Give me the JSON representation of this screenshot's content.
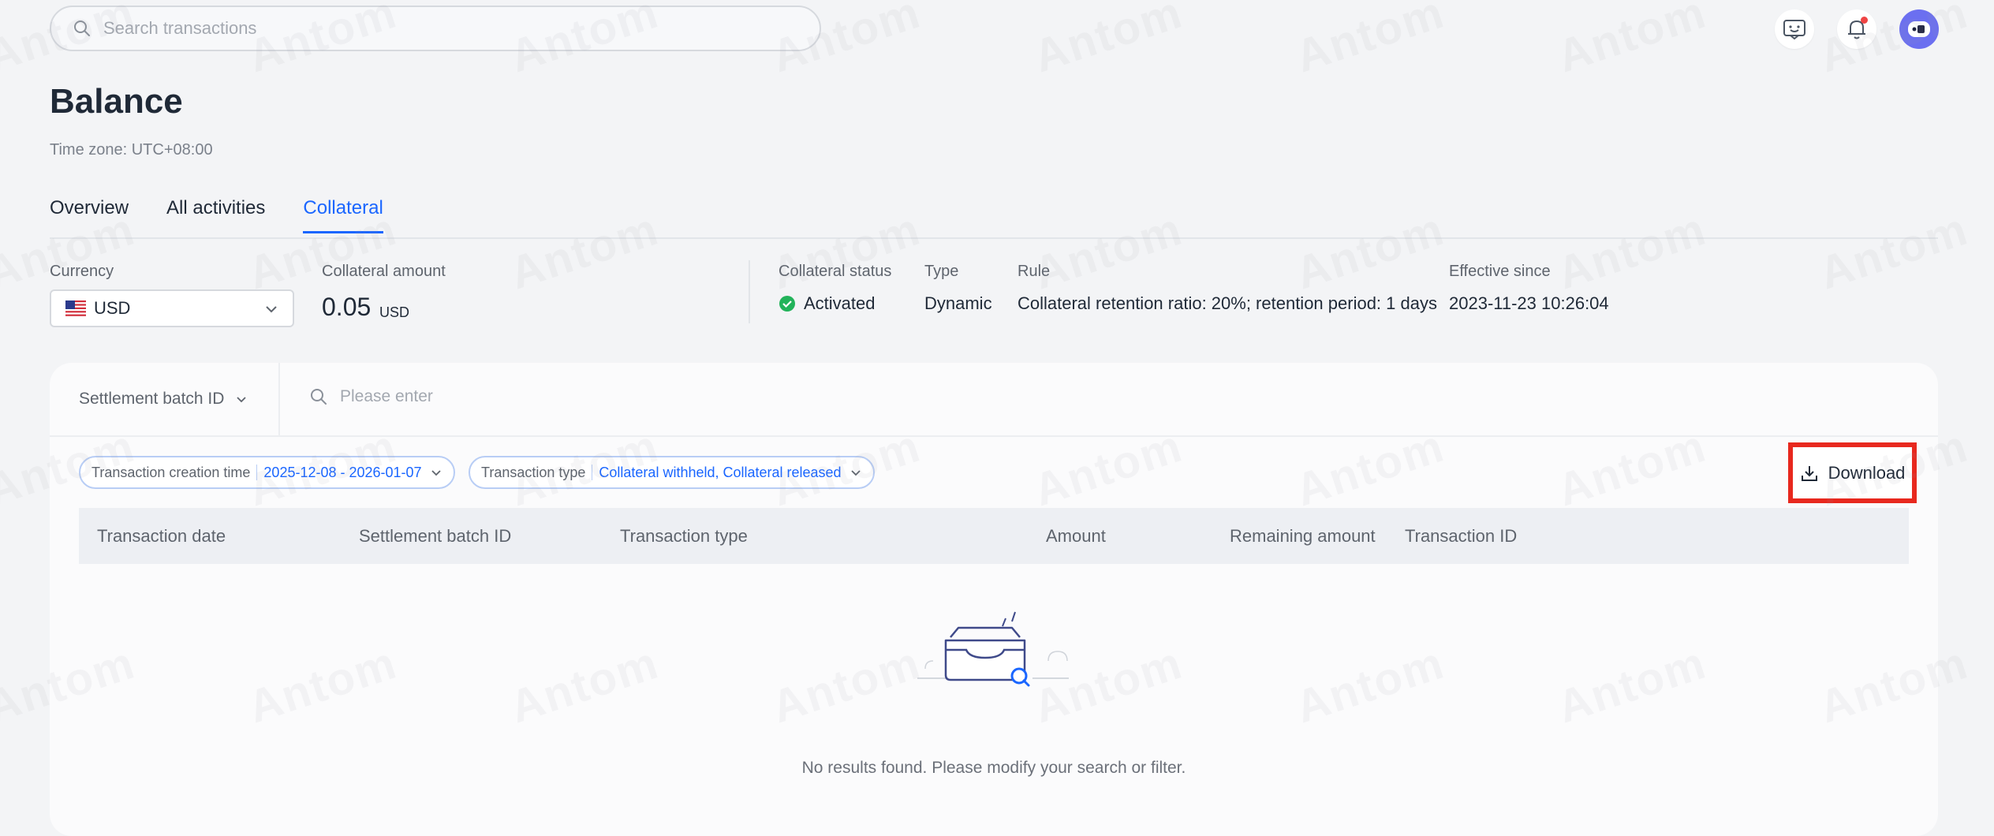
{
  "search": {
    "placeholder": "Search transactions"
  },
  "header": {
    "title": "Balance",
    "timezone": "Time zone: UTC+08:00"
  },
  "tabs": [
    {
      "label": "Overview",
      "active": false
    },
    {
      "label": "All activities",
      "active": false
    },
    {
      "label": "Collateral",
      "active": true
    }
  ],
  "info": {
    "currency_label": "Currency",
    "currency_value": "USD",
    "collateral_amount_label": "Collateral amount",
    "collateral_amount_value": "0.05",
    "collateral_amount_unit": "USD",
    "status_label": "Collateral status",
    "status_value": "Activated",
    "type_label": "Type",
    "type_value": "Dynamic",
    "rule_label": "Rule",
    "rule_value": "Collateral retention ratio: 20%; retention period: 1 days",
    "effective_label": "Effective since",
    "effective_value": "2023-11-23 10:26:04"
  },
  "filters": {
    "batch_select_label": "Settlement batch ID",
    "search_placeholder": "Please enter",
    "chips": [
      {
        "label": "Transaction creation time",
        "value": "2025-12-08 - 2026-01-07"
      },
      {
        "label": "Transaction type",
        "value": "Collateral withheld, Collateral released"
      }
    ],
    "download_label": "Download"
  },
  "table": {
    "columns": [
      "Transaction date",
      "Settlement batch ID",
      "Transaction type",
      "Amount",
      "Remaining amount",
      "Transaction ID"
    ],
    "empty_message": "No results found. Please modify your search or filter."
  },
  "watermark": "Antom",
  "colors": {
    "accent": "#1a66ff",
    "status_success": "#22b35a",
    "highlight_border": "#e8281e"
  },
  "icons": {
    "search": "search-icon",
    "feedback": "feedback-icon",
    "bell": "bell-icon",
    "avatar": "avatar-icon",
    "download": "download-icon",
    "chevron": "chevron-down-icon",
    "flag": "us-flag-icon",
    "check": "check-circle-icon"
  }
}
